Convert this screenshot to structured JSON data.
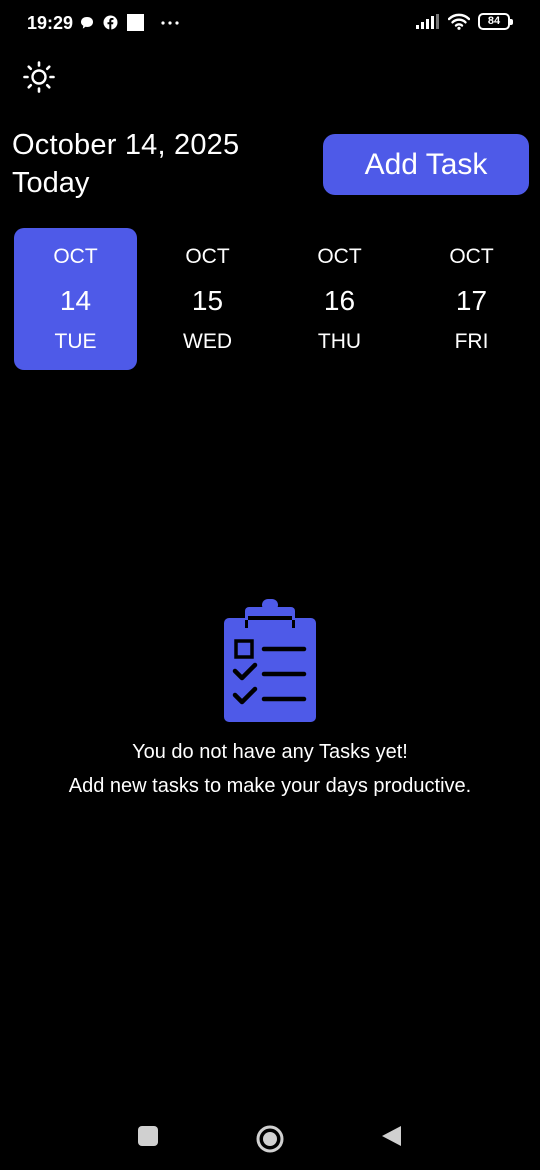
{
  "status_bar": {
    "time": "19:29",
    "battery": "84",
    "left_icons": [
      "chat-bubble-icon",
      "facebook-icon",
      "square-notification-icon",
      "more-dots-icon"
    ],
    "right_icons": [
      "signal-icon",
      "wifi-icon",
      "battery-icon"
    ]
  },
  "header": {
    "date": "October 14, 2025",
    "today_label": "Today",
    "add_task_label": "Add Task",
    "theme_icon": "sun-icon"
  },
  "date_strip": [
    {
      "month": "OCT",
      "day": "14",
      "weekday": "TUE",
      "selected": true
    },
    {
      "month": "OCT",
      "day": "15",
      "weekday": "WED",
      "selected": false
    },
    {
      "month": "OCT",
      "day": "16",
      "weekday": "THU",
      "selected": false
    },
    {
      "month": "OCT",
      "day": "17",
      "weekday": "FRI",
      "selected": false
    }
  ],
  "empty_state": {
    "icon": "clipboard-checklist-icon",
    "line1": "You do not have any Tasks yet!",
    "line2": "Add new tasks to make your days productive."
  },
  "nav_bar": {
    "icons": [
      "recent-apps-icon",
      "home-icon",
      "back-icon"
    ]
  },
  "colors": {
    "accent": "#4e5ae8",
    "background": "#000000",
    "text": "#ffffff"
  }
}
